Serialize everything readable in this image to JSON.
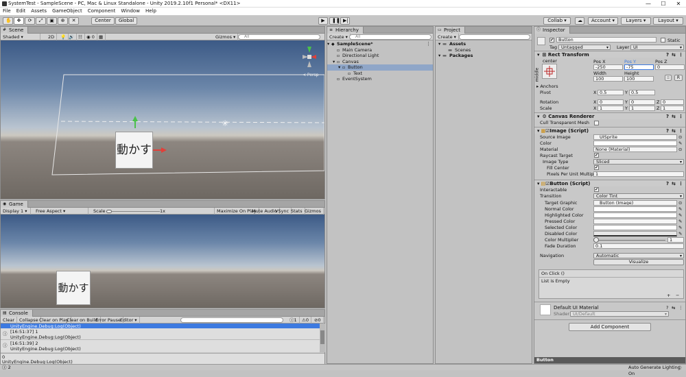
{
  "window": {
    "title": "SystemTest - SampleScene - PC, Mac & Linux Standalone - Unity 2019.2.10f1 Personal* <DX11>",
    "min": "—",
    "max": "☐",
    "close": "✕"
  },
  "menu": [
    "File",
    "Edit",
    "Assets",
    "GameObject",
    "Component",
    "Window",
    "Help"
  ],
  "toolbar": {
    "center": "Center",
    "global": "Global",
    "collab": "Collab ▾",
    "account": "Account",
    "layers": "Layers",
    "layout": "Layout",
    "play_icon": "play-icon",
    "pause_icon": "pause-icon",
    "step_icon": "step-icon"
  },
  "scene": {
    "tab": "Scene",
    "shading": "Shaded",
    "mode_2d": "2D",
    "gizmos": "Gizmos",
    "search_placeholder": "All",
    "persp": "< Persp",
    "button_text": "動かす"
  },
  "game": {
    "tab": "Game",
    "display": "Display 1",
    "aspect": "Free Aspect",
    "scale_label": "Scale",
    "scale_value": "1x",
    "maximize": "Maximize On Play",
    "mute": "Mute Audio",
    "vsync": "VSync",
    "stats": "Stats",
    "gizmos": "Gizmos",
    "button_text": "動かす"
  },
  "hierarchy": {
    "tab": "Hierarchy",
    "create": "Create",
    "search_placeholder": "All",
    "items": [
      {
        "label": "SampleScene*",
        "depth": 0,
        "bold": true,
        "selected": false
      },
      {
        "label": "Main Camera",
        "depth": 1,
        "selected": false
      },
      {
        "label": "Directional Light",
        "depth": 1,
        "selected": false
      },
      {
        "label": "Canvas",
        "depth": 1,
        "selected": false
      },
      {
        "label": "Button",
        "depth": 2,
        "selected": true
      },
      {
        "label": "Text",
        "depth": 3,
        "selected": false
      },
      {
        "label": "EventSystem",
        "depth": 1,
        "selected": false
      }
    ]
  },
  "project": {
    "tab": "Project",
    "create": "Create",
    "items": [
      {
        "label": "Assets",
        "depth": 0,
        "bold": true
      },
      {
        "label": "Scenes",
        "depth": 1
      },
      {
        "label": "Packages",
        "depth": 0,
        "bold": true
      }
    ]
  },
  "console": {
    "tab": "Console",
    "buttons": [
      "Clear",
      "Collapse",
      "Clear on Play",
      "Clear on Build",
      "Error Pause",
      "Editor ▾"
    ],
    "counts": {
      "info": "1",
      "warn": "0",
      "error": "0"
    },
    "entries": [
      {
        "line1": "",
        "line2": "UnityEngine.Debug:Log(Object)",
        "selected": true
      },
      {
        "line1": "[16:51:37] 1",
        "line2": "UnityEngine.Debug:Log(Object)",
        "selected": false
      },
      {
        "line1": "[16:51:39] 2",
        "line2": "UnityEngine.Debug:Log(Object)",
        "selected": false
      }
    ],
    "detail": [
      "0",
      "UnityEngine.Debug:Log(Object)"
    ]
  },
  "inspector": {
    "tab": "Inspector",
    "object_name": "Button",
    "static": "Static",
    "tag_label": "Tag",
    "tag": "Untagged",
    "layer_label": "Layer",
    "layer": "UI",
    "rect_transform": {
      "title": "Rect Transform",
      "anchor_top": "center",
      "anchor_side": "middle",
      "posx_label": "Pos X",
      "posy_label": "Pos Y",
      "posz_label": "Pos Z",
      "posx": "-250",
      "posy": "-75",
      "posz": "0",
      "width_label": "Width",
      "height_label": "Height",
      "width": "100",
      "height": "100",
      "r_btn": "R",
      "anchors": "Anchors",
      "pivot_label": "Pivot",
      "pivot_x": "0.5",
      "pivot_y": "0.5",
      "rotation_label": "Rotation",
      "rot_x": "0",
      "rot_y": "0",
      "rot_z": "0",
      "scale_label": "Scale",
      "scale_x": "1",
      "scale_y": "1",
      "scale_z": "1",
      "x": "X",
      "y": "Y",
      "z": "Z"
    },
    "canvas_renderer": {
      "title": "Canvas Renderer",
      "cull": "Cull Transparent Mesh"
    },
    "image": {
      "title": "Image (Script)",
      "source_image_label": "Source Image",
      "source_image": "UISprite",
      "color_label": "Color",
      "material_label": "Material",
      "material": "None (Material)",
      "raycast_label": "Raycast Target",
      "image_type_label": "Image Type",
      "image_type": "Sliced",
      "fill_center_label": "Fill Center",
      "ppu_label": "Pixels Per Unit Multiplier",
      "ppu": "1"
    },
    "button": {
      "title": "Button (Script)",
      "interactable_label": "Interactable",
      "transition_label": "Transition",
      "transition": "Color Tint",
      "target_graphic_label": "Target Graphic",
      "target_graphic": "Button (Image)",
      "normal_label": "Normal Color",
      "highlighted_label": "Highlighted Color",
      "pressed_label": "Pressed Color",
      "selected_label": "Selected Color",
      "disabled_label": "Disabled Color",
      "multiplier_label": "Color Multiplier",
      "multiplier": "1",
      "fade_label": "Fade Duration",
      "fade": "0.1",
      "navigation_label": "Navigation",
      "navigation": "Automatic",
      "visualize": "Visualize",
      "onclick": "On Click ()",
      "list_empty": "List is Empty",
      "plus": "+",
      "minus": "−"
    },
    "material": {
      "title": "Default UI Material",
      "shader_label": "Shader",
      "shader": "UI/Default"
    },
    "add_component": "Add Component",
    "footer_name": "Button"
  },
  "status": {
    "left": "2",
    "right": "Auto Generate Lighting On"
  },
  "colors": {
    "selection": "#3d7ae0",
    "panel": "#c2c2c2",
    "tab_active": "#cbcbcb"
  }
}
